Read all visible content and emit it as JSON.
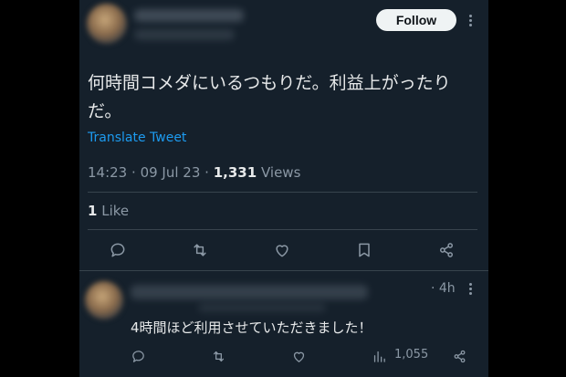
{
  "tweet": {
    "follow_label": "Follow",
    "text_line1": "何時間コメダにいるつもりだ。利益上がったり",
    "text_line2": "だ。",
    "translate_label": "Translate Tweet",
    "time": "14:23",
    "date": "09 Jul 23",
    "views_count": "1,331",
    "views_label": "Views",
    "separator": "·",
    "likes_count": "1",
    "likes_label": "Like"
  },
  "reply": {
    "time": "· 4h",
    "text": "4時間ほど利用させていただきました！",
    "views": "1,055"
  },
  "colors": {
    "background": "#15202b",
    "text": "#e7e9ea",
    "muted": "#8b98a5",
    "link": "#1d9bf0",
    "divider": "#38444d"
  },
  "icons": [
    "more-icon",
    "reply-icon",
    "retweet-icon",
    "like-icon",
    "bookmark-icon",
    "share-icon",
    "views-icon"
  ]
}
